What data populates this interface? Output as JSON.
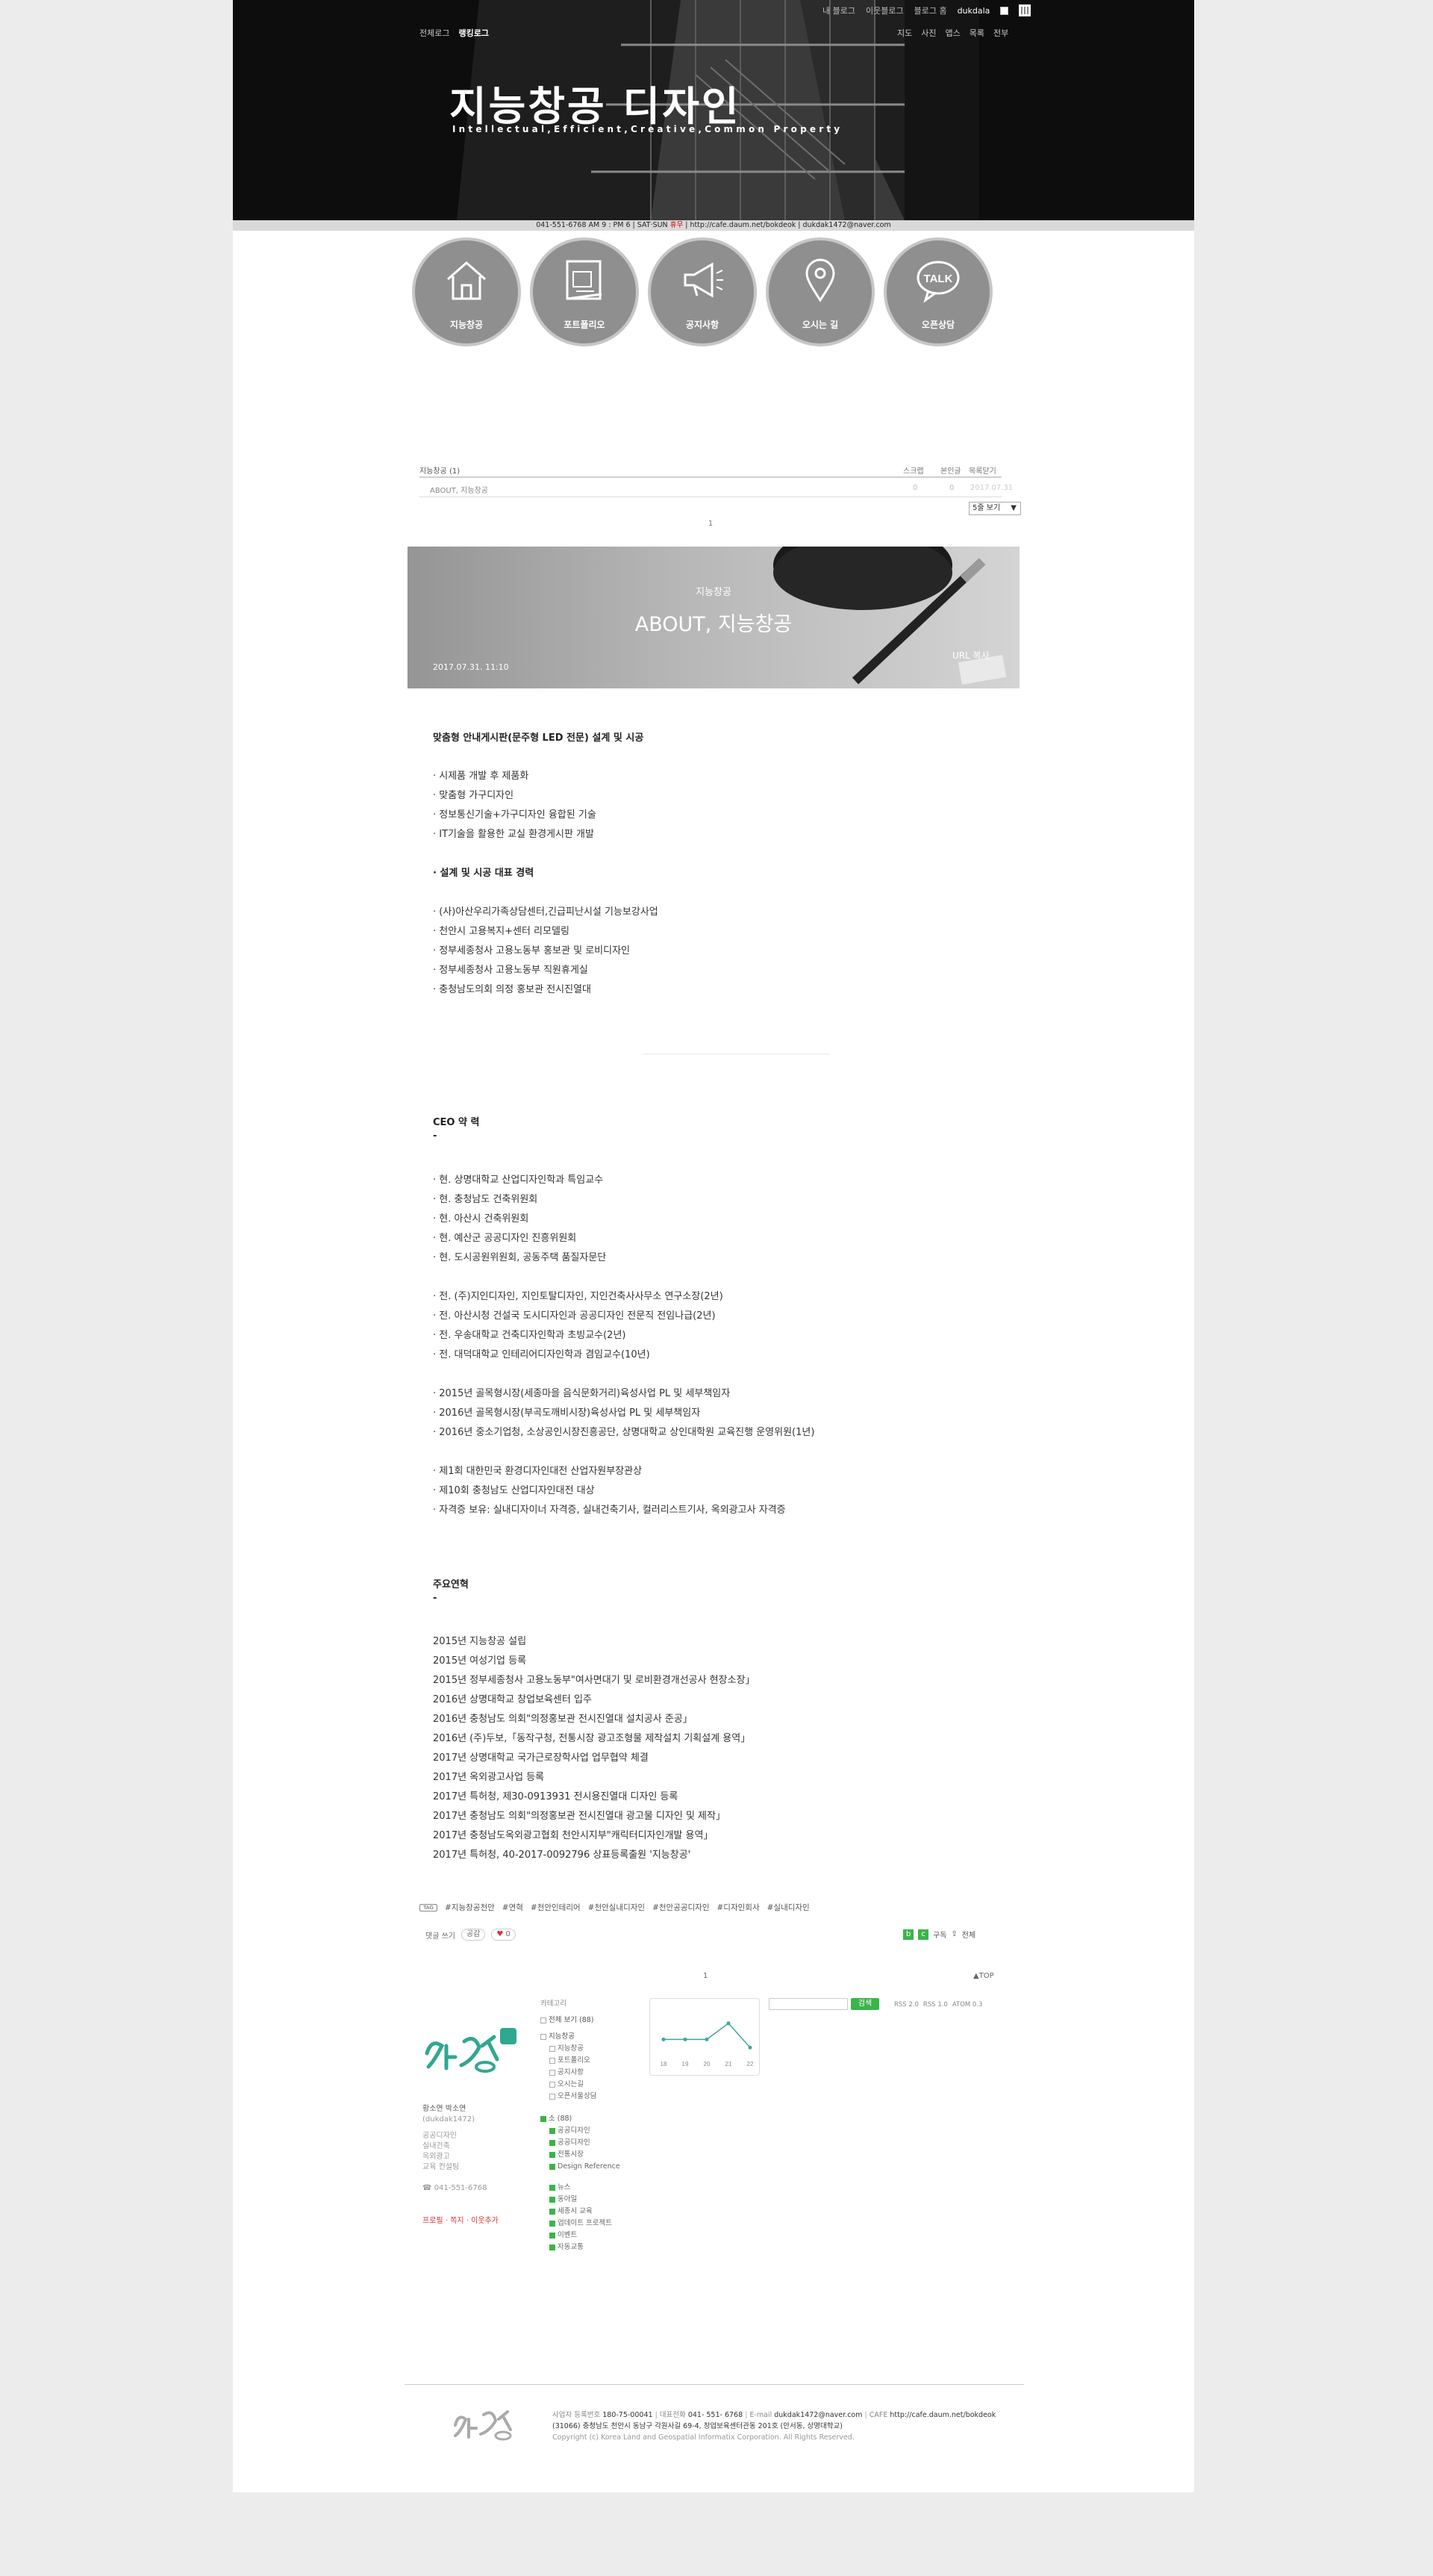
{
  "header": {
    "topnav_left": [
      "전체로그",
      "랭킹로그"
    ],
    "topnav_right": [
      "내 블로그",
      "이웃블로그",
      "블로그 홈"
    ],
    "account": "dukdala",
    "menu_right": [
      "지도",
      "사진",
      "앱스",
      "목록",
      "전부"
    ],
    "title": "지능창공 디자인",
    "subtitle": "Intellectual,Efficient,Creative,Common Property",
    "infobar": {
      "left": "041-551-6768 AM 9 : PM 6",
      "sun_prefix": "SAT·SUN",
      "sun": "휴무",
      "url": "http://cafe.daum.net/bokdeok",
      "email": "dukdak1472@naver.com"
    }
  },
  "nav_circles": [
    {
      "label": "지능창공",
      "icon": "house-icon"
    },
    {
      "label": "포트폴리오",
      "icon": "blueprint-icon"
    },
    {
      "label": "공지사항",
      "icon": "megaphone-icon"
    },
    {
      "label": "오시는 길",
      "icon": "map-pin-icon"
    },
    {
      "label": "오픈상담",
      "icon": "talk-bubble-icon",
      "icon_text": "TALK"
    }
  ],
  "post_list": {
    "title": "지능창공 (1)",
    "columns": [
      "스크랩",
      "본인글",
      "목록닫기"
    ],
    "rows": [
      {
        "title": "ABOUT, 지능창공",
        "c1": "0",
        "c2": "0",
        "date": "2017.07.31"
      }
    ],
    "view_select": "5줄 보기",
    "page": "1"
  },
  "banner": {
    "category": "지능창공",
    "title": "ABOUT, 지능창공",
    "date": "2017.07.31. 11:10",
    "url_copy": "URL 복사"
  },
  "article": {
    "heading1": "맞춤형 안내게시판(문주형 LED 전문) 설계 및 시공",
    "list1": [
      "· 시제품 개발 후 제품화",
      "· 맞춤형 가구디자인",
      "· 정보통신기술+가구디자인 융합된 기술",
      "· IT기술을 활용한 교실 환경게시판 개발"
    ],
    "heading2": "· 설계 및 시공 대표 경력",
    "list2": [
      "· (사)아산우리가족상담센터,긴급피난시설 기능보강사업",
      "· 천안시 고용복지+센터 리모델링",
      "· 정부세종청사 고용노동부 홍보관 및 로비디자인",
      "· 정부세종청사 고용노동부 직원휴게실",
      "· 충청남도의회 의정 홍보관 전시진열대"
    ],
    "ceo_heading": "CEO 약 력",
    "ceo_dash": "-",
    "ceo_group1": [
      "· 현. 상명대학교 산업디자인학과 특임교수",
      "· 현. 충청남도 건축위원회",
      "· 현. 아산시 건축위원회",
      "· 현. 예산군 공공디자인 진흥위원회",
      "· 현. 도시공원위원회, 공동주택 품질자문단"
    ],
    "ceo_group2": [
      "· 전. (주)지인디자인, 지인토탈디자인, 지인건축사사무소 연구소장(2년)",
      "· 전. 아산시청 건설국 도시디자인과 공공디자인 전문직 전임나급(2년)",
      "· 전. 우송대학교 건축디자인학과 초빙교수(2년)",
      "· 전. 대덕대학교 인테리어디자인학과 겸임교수(10년)"
    ],
    "ceo_group3": [
      "· 2015년 골목형시장(세종마을 음식문화거리)육성사업 PL 및 세부책임자",
      "· 2016년 골목형시장(부곡도깨비시장)육성사업 PL 및 세부책임자",
      "· 2016년 중소기업청, 소상공인시장진흥공단, 상명대학교 상인대학원 교육진행 운영위원(1년)"
    ],
    "ceo_group4": [
      "· 제1회 대한민국 환경디자인대전 산업자원부장관상",
      "· 제10회 충청남도 산업디자인대전 대상",
      "· 자격증 보유: 실내디자이너 자격증, 실내건축기사, 컬러리스트기사, 옥외광고사 자격증"
    ],
    "history_heading": "주요연혁",
    "history_dash": "-",
    "history": [
      "2015년 지능창공 설립",
      "2015년 여성기업 등록",
      "2015년 정부세종청사 고용노동부\"여사면대기 및 로비환경개선공사 현장소장」",
      "2016년 상명대학교 창업보육센터 입주",
      "2016년 충청남도 의회\"의정홍보관 전시진열대 설치공사 준공」",
      "2016년 (주)두보,「동작구청, 전통시장 광고조형물 제작설치 기획설계 용역」",
      "2017년 상명대학교 국가근로장학사업 업무협약 체결",
      "2017년 옥외광고사업 등록",
      "2017년 특허청, 제30-0913931 전시용진열대 디자인 등록",
      "2017년 충청남도 의회\"의정홍보관 전시진열대 광고물 디자인 및 제작」",
      "2017년 충청남도옥외광고협회 천안시지부\"캐릭터디자인개발 용역」",
      "2017년 특허청, 40-2017-0092796 상표등록출원 '지능창공'"
    ]
  },
  "tags": [
    "#지능창공천안",
    "#연혁",
    "#천안인테리어",
    "#천안실내디자인",
    "#천안공공디자인",
    "#디자인회사",
    "#실내디자인"
  ],
  "actions": {
    "comment": "댓글 쓰기",
    "share": "공감",
    "like_count": "0",
    "subscribe": "구독",
    "share_btn": "전체"
  },
  "pager": {
    "page": "1",
    "top": "▲TOP"
  },
  "sidebar": {
    "author_name": "황소연 박소연",
    "author_id": "(dukdak1472)",
    "author_lines": [
      "공공디자인",
      "실내건축",
      "옥외광고",
      "교육 컨설팅"
    ],
    "phone": "041-551-6768",
    "links": "프로필 · 쪽지 · 이웃추가",
    "cat_header": "카테고리",
    "cat_all": "전체 보기 (88)",
    "cat_group1": "지능창공",
    "cat_sub1": [
      "지능창공",
      "포트폴리오",
      "공지사항",
      "오시는길",
      "오픈서울상담"
    ],
    "cat_group2": "소 (88)",
    "cat_sub2": [
      "공공디자인",
      "공공디자인",
      "전통시장",
      "Design Reference"
    ],
    "cat_sub3": [
      "뉴스",
      "동아일",
      "세종시 교육",
      "업데이트 프로젝트",
      "이벤트",
      "자동교통"
    ],
    "chart_axis": [
      "18",
      "19",
      "20",
      "21",
      "22"
    ],
    "search_button": "검색",
    "stats": [
      "RSS 2.0",
      "RSS 1.0",
      "ATOM 0.3"
    ]
  },
  "footer": {
    "line1_label1": "사업자 등록번호",
    "line1_val1": "180-75-00041",
    "line1_label2": "대표전화",
    "line1_val2": "041- 551- 6768",
    "line1_label3": "E-mail",
    "line1_val3": "dukdak1472@naver.com",
    "line1_label4": "CAFE",
    "line1_val4": "http://cafe.daum.net/bokdeok",
    "line2": "(31066) 충청남도 천안시 동남구 각원사길 69-4, 창업보육센터관동 201호 (안서동, 상명대학교)",
    "line3": "Copyright (c) Korea Land and Geospatial Informatix Corporation. All Rights Reserved."
  },
  "chart_data": {
    "type": "line",
    "categories": [
      "18",
      "19",
      "20",
      "21",
      "22"
    ],
    "values": [
      2,
      2,
      2,
      4,
      1
    ],
    "title": "",
    "xlabel": "",
    "ylabel": ""
  }
}
